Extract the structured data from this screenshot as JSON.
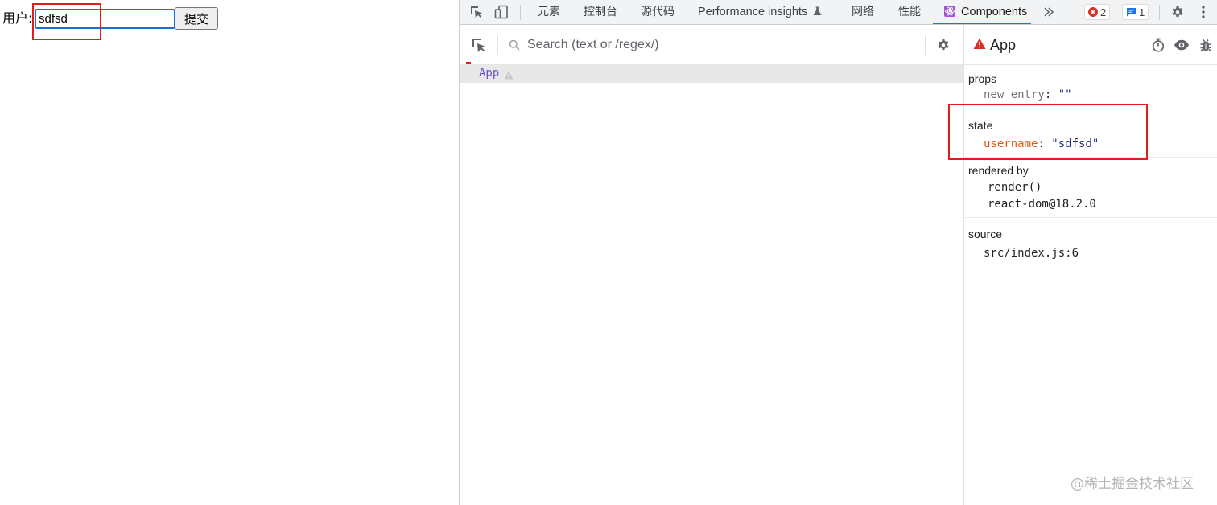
{
  "page": {
    "username_label": "用户:",
    "username_value": "sdfsd",
    "submit_label": "提交"
  },
  "devtools": {
    "tabs": [
      "元素",
      "控制台",
      "源代码",
      "Performance insights",
      "网络",
      "性能",
      "Components"
    ],
    "active_tab": "Components",
    "more_tabs_icon": "chevron-double-right-icon",
    "error_count": "2",
    "message_count": "1",
    "colors": {
      "accent": "#1a73e8",
      "error": "#d93025",
      "state_key": "#e8550f",
      "string_value": "#1d2a88",
      "component_name": "#6c4fc4",
      "annotation": "#e21b1b"
    }
  },
  "tree": {
    "search_placeholder": "Search (text or /regex/)",
    "root_component": "App"
  },
  "inspector": {
    "title": "App",
    "props": {
      "heading": "props",
      "key": "new entry",
      "value": "\"\""
    },
    "state": {
      "heading": "state",
      "key": "username",
      "value": "\"sdfsd\""
    },
    "rendered_by": {
      "heading": "rendered by",
      "items": [
        "render()",
        "react-dom@18.2.0"
      ]
    },
    "source": {
      "heading": "source",
      "value": "src/index.js:6"
    }
  },
  "watermark": "@稀土掘金技术社区"
}
